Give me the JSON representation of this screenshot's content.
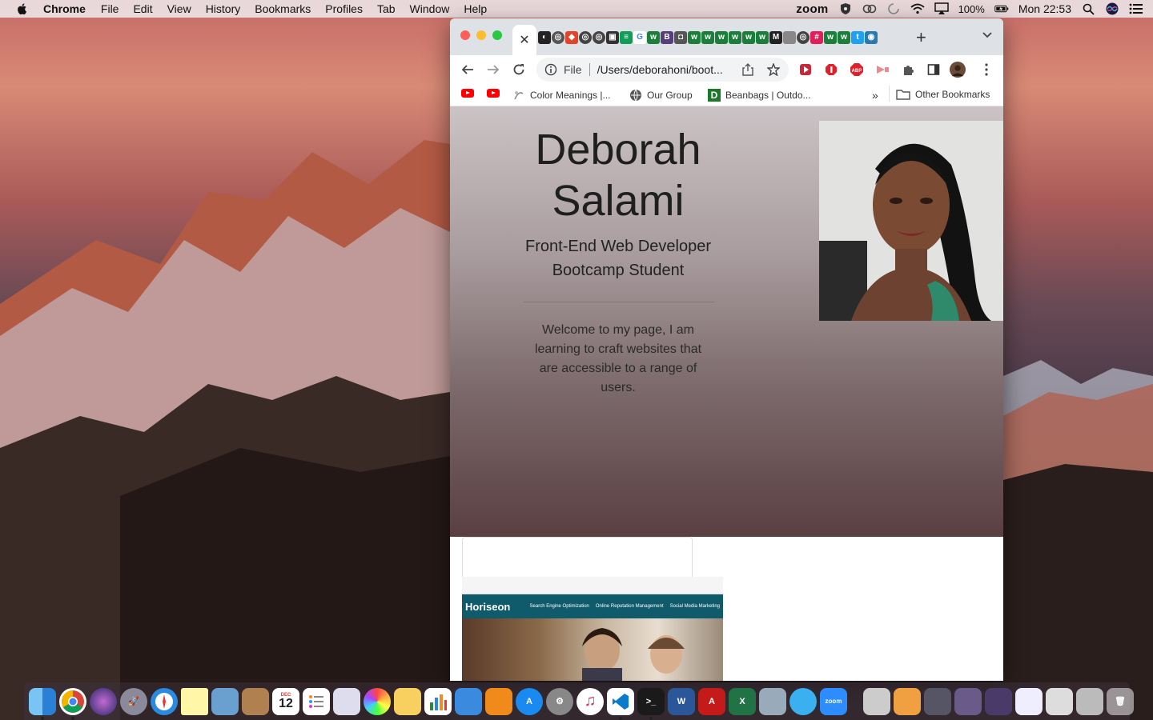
{
  "menubar": {
    "app_name": "Chrome",
    "menus": [
      "File",
      "Edit",
      "View",
      "History",
      "Bookmarks",
      "Profiles",
      "Tab",
      "Window",
      "Help"
    ],
    "zoom_label": "zoom",
    "battery": "100%",
    "clock": "Mon 22:53"
  },
  "browser": {
    "active_tab_close": "✕",
    "new_tab": "+",
    "address": {
      "scheme": "File",
      "url": "/Users/deborahoni/boot..."
    },
    "bookmarks": [
      {
        "label": "",
        "icon": "youtube-icon"
      },
      {
        "label": "",
        "icon": "youtube-icon"
      },
      {
        "label": "Color Meanings |...",
        "icon": "color-meanings-icon"
      },
      {
        "label": "Our Group",
        "icon": "globe-icon"
      },
      {
        "label": "Beanbags | Outdo...",
        "icon": "d-icon"
      }
    ],
    "bookmarks_more": "»",
    "other_bookmarks": "Other Bookmarks"
  },
  "page": {
    "name": "Deborah Salami",
    "subtitle_line1": "Front-End Web Developer",
    "subtitle_line2": "Bootcamp Student",
    "welcome": "Welcome to my page, I am learning to craft websites that are accessible to a range of users.",
    "project_preview": {
      "brand": "Horiseon",
      "links": [
        "Search Engine Optimization",
        "Online Reputation Management",
        "Social Media Marketing"
      ]
    }
  },
  "dock": {
    "calendar_month": "DEC",
    "calendar_day": "12",
    "zoom_label": "zoom"
  },
  "colors": {
    "hero_top": "#cbc3c5",
    "hero_bottom": "#5a3f41",
    "horiseon_header": "#0f5a6b"
  }
}
